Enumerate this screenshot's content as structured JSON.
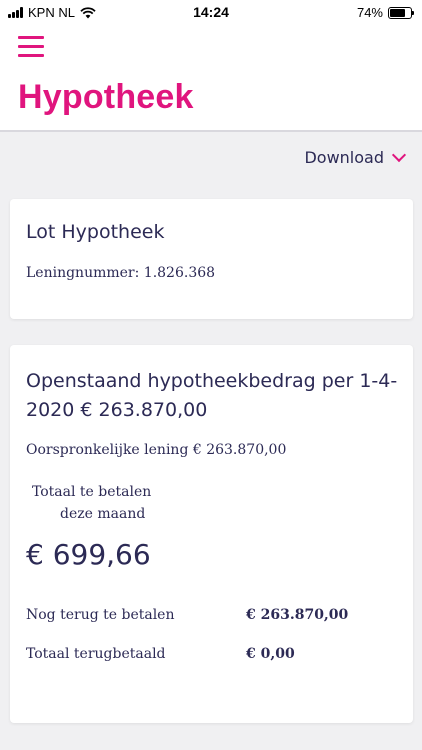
{
  "status_bar": {
    "carrier": "KPN NL",
    "time": "14:24",
    "battery": "74%"
  },
  "header": {
    "title": "Hypotheek",
    "menu_icon": "hamburger-menu-icon"
  },
  "download": {
    "label": "Download",
    "icon": "chevron-down-icon"
  },
  "loan_card": {
    "title": "Lot Hypotheek",
    "loan_number": "Leningnummer: 1.826.368"
  },
  "balance_card": {
    "title": "Openstaand hypotheekbedrag per 1-4-2020 € 263.870,00",
    "original_loan": "Oorspronkelijke lening € 263.870,00",
    "total_label_1": "Totaal te betalen",
    "total_label_2": "deze maand",
    "monthly_amount": "€ 699,66",
    "rows": [
      {
        "label": "Nog terug te betalen",
        "value": "€ 263.870,00"
      },
      {
        "label": "Totaal terugbetaald",
        "value": "€ 0,00"
      }
    ]
  },
  "colors": {
    "accent": "#e0157e",
    "text": "#2c2a55",
    "background": "#f0f0f2"
  }
}
